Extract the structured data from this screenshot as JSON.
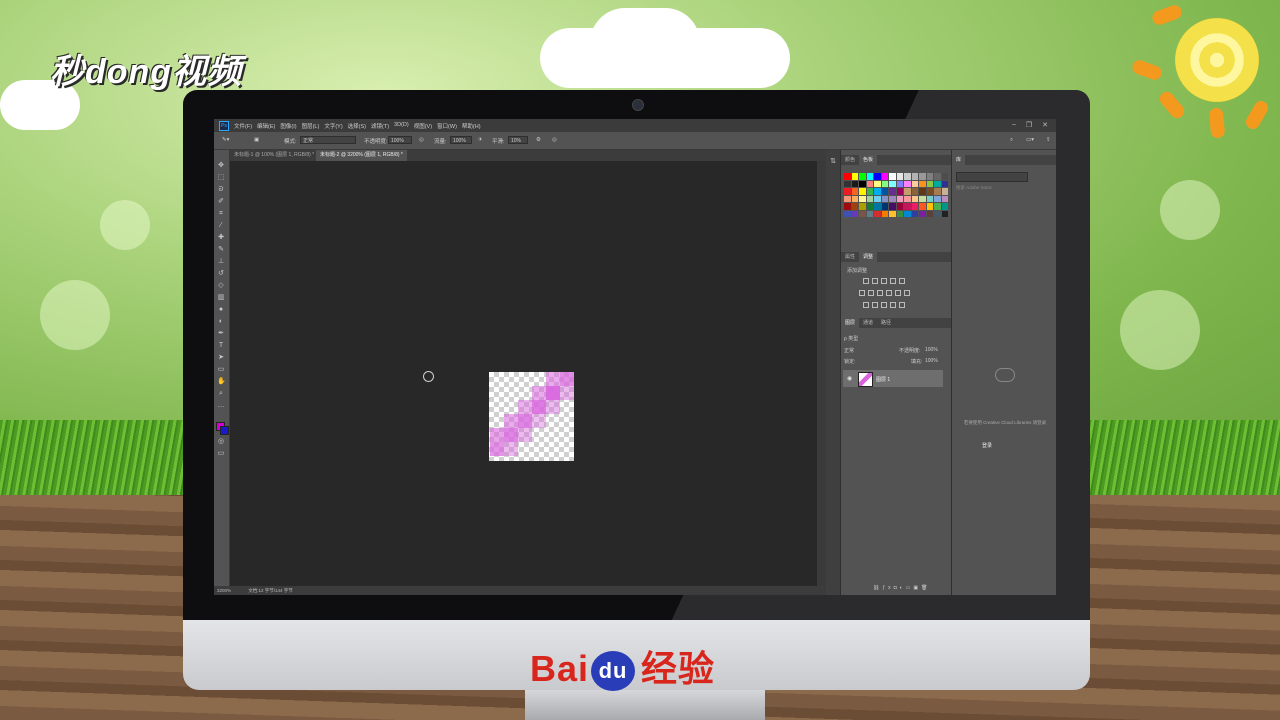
{
  "watermark_logo": "秒dong视频",
  "baidu_logo": {
    "bai": "Bai",
    "du": "du",
    "jingyan": "经验"
  },
  "ps": {
    "app_icon": "Ps",
    "menus": [
      "文件(F)",
      "编辑(E)",
      "图像(I)",
      "图层(L)",
      "文字(Y)",
      "选择(S)",
      "滤镜(T)",
      "3D(D)",
      "视图(V)",
      "窗口(W)",
      "帮助(H)"
    ],
    "options": {
      "mode_label": "模式:",
      "mode_value": "正常",
      "opacity_label": "不透明度:",
      "opacity_value": "100%",
      "flow_label": "流量:",
      "flow_value": "100%",
      "smooth_label": "平滑:",
      "smooth_value": "10%"
    },
    "tabs": [
      {
        "label": "未标题-1 @ 100% (图层 1, RGB/8) *",
        "active": false
      },
      {
        "label": "未标题-2 @ 3200% (图层 1, RGB/8) *",
        "active": true
      }
    ],
    "status": {
      "zoom": "3200%",
      "doc": "文档:12 字节/144 字节"
    },
    "colors_panel": {
      "tabs": [
        "颜色",
        "色板"
      ],
      "active": "色板"
    },
    "adjust_panel": {
      "tabs": [
        "属性",
        "调整"
      ],
      "active": "调整",
      "title": "添加调整"
    },
    "layers_panel": {
      "tabs": [
        "图层",
        "通道",
        "路径"
      ],
      "kind_label": "ρ 类型",
      "blend_mode": "正常",
      "opacity_label": "不透明度:",
      "opacity_value": "100%",
      "lock_label": "锁定:",
      "fill_label": "填充:",
      "fill_value": "100%",
      "layer_name": "图层 1"
    },
    "libraries": {
      "tab": "库",
      "search_placeholder": "搜索 Adobe Stock",
      "message": "若要使用 Creative Cloud Libraries 请登录",
      "link": "登录"
    }
  },
  "colors": {
    "foreground": "#d400d4",
    "background": "#1a1acc",
    "pixel_magenta": "#d865de"
  }
}
